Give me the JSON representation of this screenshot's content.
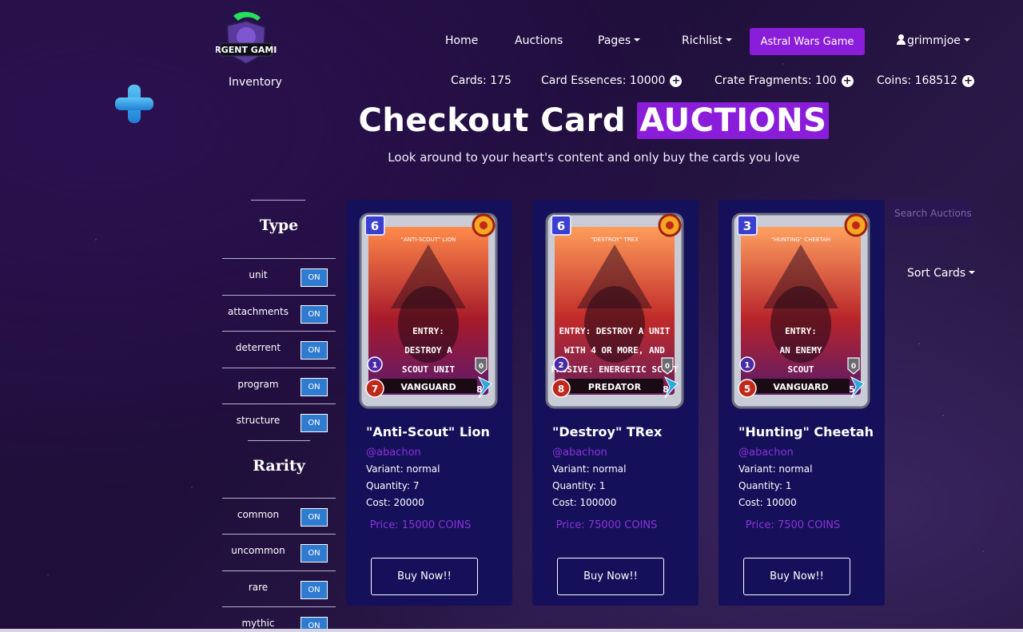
{
  "header": {
    "inventory_label": "Inventory",
    "logo_text": "SURGENT GAMING"
  },
  "nav": {
    "home": "Home",
    "auctions": "Auctions",
    "pages": "Pages",
    "richlist": "Richlist",
    "game_button": "Astral Wars Game",
    "username": "grimmjoe"
  },
  "stats": {
    "cards": "Cards: 175",
    "card_essences": "Card Essences: 10000",
    "crate_fragments": "Crate Fragments: 100",
    "coins": "Coins: 168512"
  },
  "hero": {
    "title_plain": "Checkout Card",
    "title_highlight": "AUCTIONS",
    "subtitle": "Look around to your heart's content and only buy the cards you love"
  },
  "filters": {
    "type_title": "Type",
    "type_items": [
      {
        "label": "unit",
        "state": "ON"
      },
      {
        "label": "attachments",
        "state": "ON"
      },
      {
        "label": "deterrent",
        "state": "ON"
      },
      {
        "label": "program",
        "state": "ON"
      },
      {
        "label": "structure",
        "state": "ON"
      }
    ],
    "rarity_title": "Rarity",
    "rarity_items": [
      {
        "label": "common",
        "state": "ON"
      },
      {
        "label": "uncommon",
        "state": "ON"
      },
      {
        "label": "rare",
        "state": "ON"
      },
      {
        "label": "mythic",
        "state": "ON"
      }
    ]
  },
  "cards": [
    {
      "name": "\"Anti-Scout\" Lion",
      "owner": "@abachon",
      "variant": "Variant: normal",
      "quantity": "Quantity: 7",
      "cost": "Cost: 20000",
      "price": "Price: 15000 COINS",
      "buy_label": "Buy Now!!",
      "art": {
        "cost": "6",
        "title": "\"ANTI-SCOUT\" LION",
        "text1": "ENTRY:",
        "text2": "DESTROY A",
        "text3": "SCOUT UNIT",
        "class": "VANGUARD",
        "level": "1",
        "attack": "7",
        "defense": "0",
        "speed": "8"
      }
    },
    {
      "name": "\"Destroy\" TRex",
      "owner": "@abachon",
      "variant": "Variant: normal",
      "quantity": "Quantity: 1",
      "cost": "Cost: 100000",
      "price": "Price: 75000 COINS",
      "buy_label": "Buy Now!!",
      "art": {
        "cost": "6",
        "title": "\"DESTROY\" TREX",
        "text1": "ENTRY: DESTROY A UNIT",
        "text2": "WITH 4 OR MORE, AND",
        "text3": "PASSIVE: ENERGETIC SCOUT",
        "class": "PREDATOR",
        "level": "2",
        "attack": "8",
        "defense": "0",
        "speed": "8"
      }
    },
    {
      "name": "\"Hunting\" Cheetah",
      "owner": "@abachon",
      "variant": "Variant: normal",
      "quantity": "Quantity: 1",
      "cost": "Cost: 10000",
      "price": "Price: 7500 COINS",
      "buy_label": "Buy Now!!",
      "art": {
        "cost": "3",
        "title": "\"HUNTING\" CHEETAH",
        "text1": "ENTRY:",
        "text2": "AN ENEMY",
        "text3": "SCOUT",
        "class": "VANGUARD",
        "level": "1",
        "attack": "5",
        "defense": "0",
        "speed": "5"
      }
    }
  ],
  "controls": {
    "search_placeholder": "Search Auctions",
    "sort_label": "Sort Cards"
  },
  "colors": {
    "accent": "#8a1dd9",
    "card_bg": "#14105a",
    "toggle_on": "#2f7bd0",
    "owner_text": "#8e33d8"
  }
}
